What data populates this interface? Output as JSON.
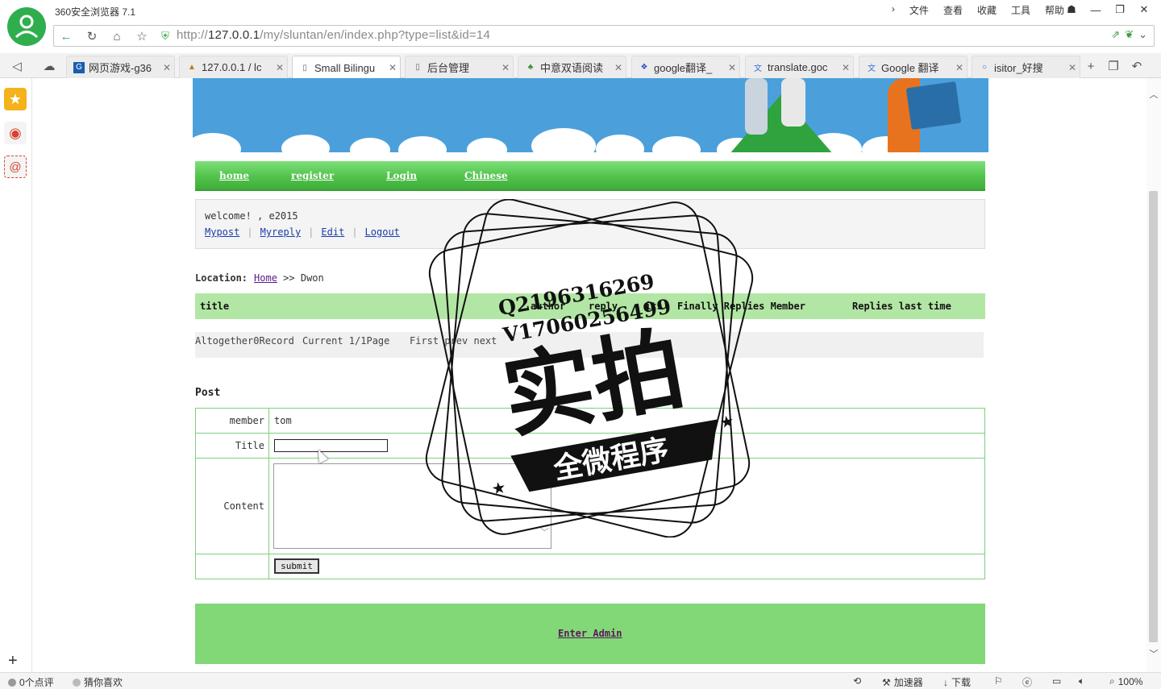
{
  "browser": {
    "title": "360安全浏览器 7.1",
    "menu": [
      "文件",
      "查看",
      "收藏",
      "工具",
      "帮助"
    ],
    "url_prefix": "http://",
    "url_host": "127.0.0.1",
    "url_path": "/my/sluntan/en/index.php?type=list&id=14",
    "tabs": [
      {
        "label": "网页游戏-g36",
        "icon": "g36-icon"
      },
      {
        "label": "127.0.0.1 / lc",
        "icon": "phpmyadmin-icon"
      },
      {
        "label": "Small Bilingu",
        "icon": "page-icon",
        "active": true
      },
      {
        "label": "后台管理",
        "icon": "page-icon"
      },
      {
        "label": "中意双语阅读",
        "icon": "site-icon"
      },
      {
        "label": "google翻译_",
        "icon": "baidu-paw-icon"
      },
      {
        "label": "translate.goc",
        "icon": "translate-icon"
      },
      {
        "label": "Google 翻译",
        "icon": "translate-icon"
      },
      {
        "label": "isitor_好搜",
        "icon": "search-icon"
      }
    ],
    "status": {
      "comments": "0个点评",
      "guess": "猜你喜欢",
      "accelerator": "加速器",
      "download": "下载",
      "zoom": "100%"
    }
  },
  "page": {
    "nav": [
      "home",
      "register",
      "Login",
      "Chinese"
    ],
    "welcome_line": "welcome! , e2015",
    "user_links": [
      "Mypost",
      "Myreply",
      "Edit",
      "Logout"
    ],
    "location_label": "Location:",
    "location_home": "Home",
    "location_rest": ">> Dwon",
    "list_headers": {
      "title": "title",
      "author": "author",
      "reply": "reply",
      "hits": "its",
      "finally": "Finally Replies Member",
      "replies_last": "Replies last time"
    },
    "pager": {
      "total": "Altogether0Record",
      "current": "Current 1/1Page",
      "nav": "First prev next"
    },
    "post_title": "Post",
    "form": {
      "member_label": "member",
      "member_value": "tom",
      "title_label": "Title",
      "content_label": "Content",
      "submit_label": "submit"
    },
    "footer_link": "Enter Admin"
  },
  "watermark": {
    "line1": "Q2196316269",
    "line2": "V17060256499",
    "big": "实拍",
    "ribbon": "全微程序"
  },
  "colors": {
    "nav_green": "#52c24c",
    "header_green": "#b2e6a4",
    "footer_green": "#82d877",
    "banner_blue": "#4ba0dc",
    "browser_green": "#2fae4e"
  }
}
